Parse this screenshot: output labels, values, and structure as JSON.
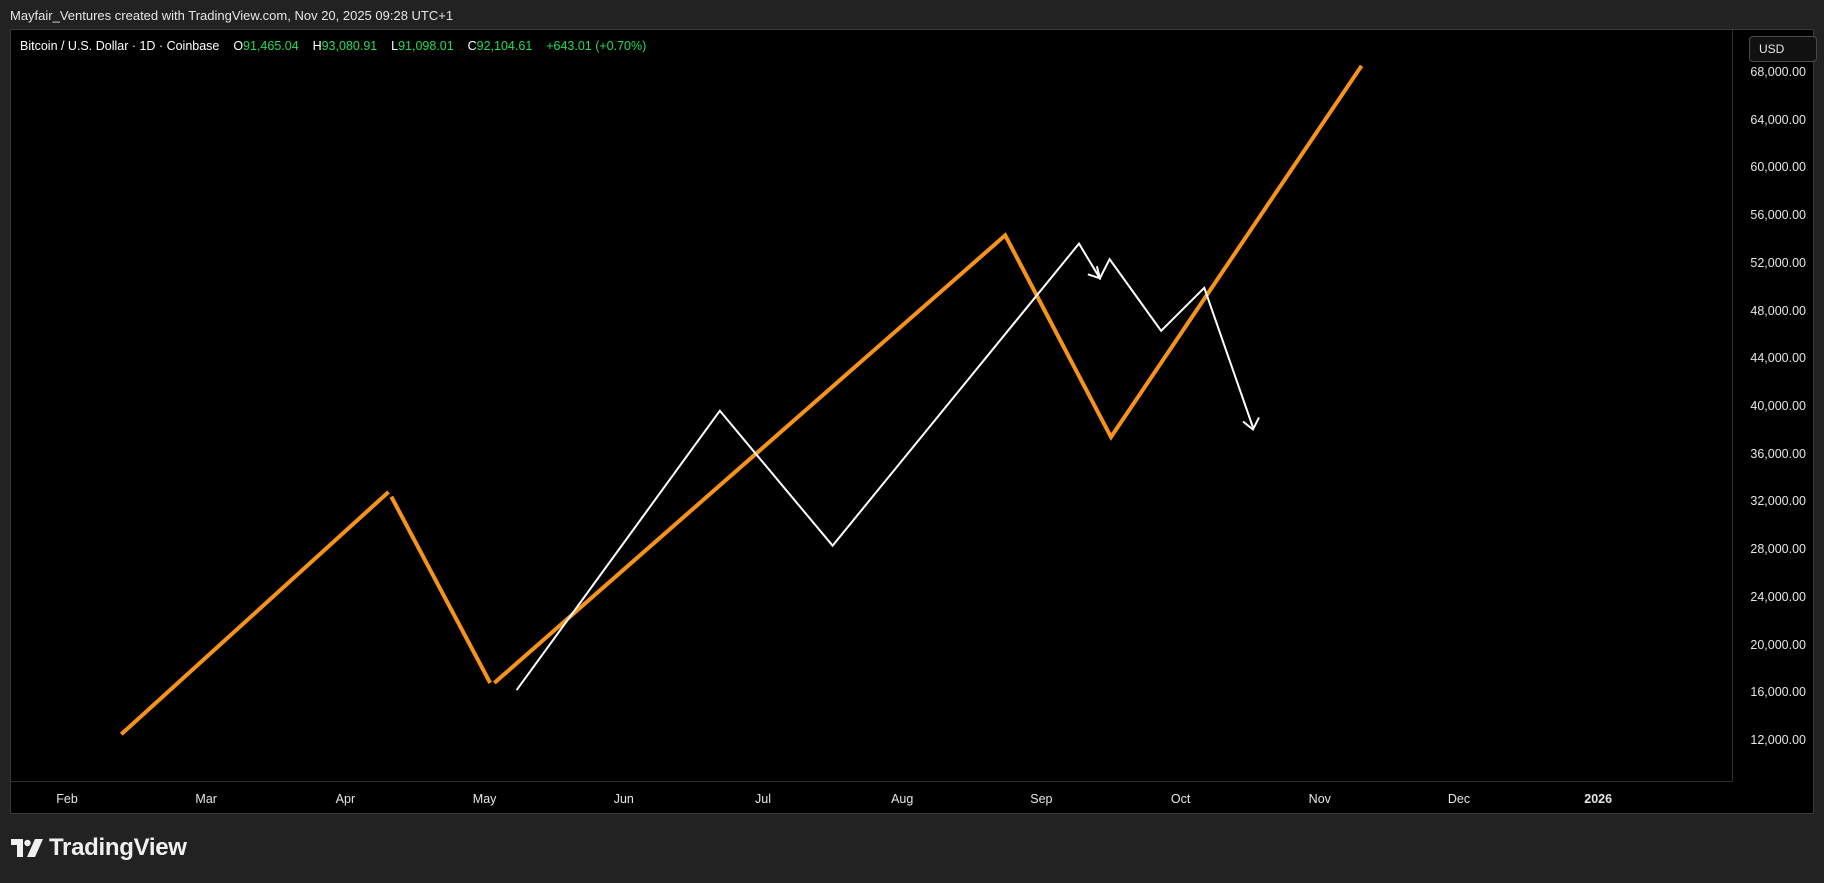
{
  "caption": "Mayfair_Ventures created with TradingView.com, Nov 20, 2025 09:28 UTC+1",
  "legend": {
    "symbol": "Bitcoin / U.S. Dollar · 1D · Coinbase",
    "o_label": "O",
    "o_value": "91,465.04",
    "h_label": "H",
    "h_value": "93,080.91",
    "l_label": "L",
    "l_value": "91,098.01",
    "c_label": "C",
    "c_value": "92,104.61",
    "change": "+643.01 (+0.70%)"
  },
  "currency_button": "USD",
  "brand": "TradingView",
  "colors": {
    "background": "#000000",
    "projection_line": "#f7931a",
    "price_path": "#ffffff",
    "legend_value": "#22dd55"
  },
  "chart_data": {
    "type": "line",
    "x_tick_labels": [
      "Feb",
      "Mar",
      "Apr",
      "May",
      "Jun",
      "Jul",
      "Aug",
      "Sep",
      "Oct",
      "Nov",
      "Dec",
      "2026"
    ],
    "y_tick_labels": [
      "68,000.00",
      "64,000.00",
      "60,000.00",
      "56,000.00",
      "52,000.00",
      "48,000.00",
      "44,000.00",
      "40,000.00",
      "36,000.00",
      "32,000.00",
      "28,000.00",
      "24,000.00",
      "20,000.00",
      "16,000.00",
      "12,000.00"
    ],
    "ylim": [
      8500,
      71500
    ],
    "x_axis": "month index (Feb = 0, 2026 = 11)",
    "series": [
      {
        "style": "orange-thick",
        "points": [
          [
            0.39,
            12500
          ],
          [
            2.31,
            32800
          ]
        ]
      },
      {
        "style": "orange-thick",
        "points": [
          [
            2.33,
            32400
          ],
          [
            3.04,
            16800
          ]
        ]
      },
      {
        "style": "orange-thick",
        "points": [
          [
            3.07,
            16800
          ],
          [
            6.74,
            54300
          ],
          [
            7.5,
            37400
          ],
          [
            9.3,
            68500
          ]
        ]
      },
      {
        "style": "white-thin",
        "points": [
          [
            3.23,
            16200
          ],
          [
            4.69,
            39600
          ],
          [
            5.5,
            28300
          ],
          [
            7.27,
            53600
          ],
          [
            7.42,
            50700
          ],
          [
            7.49,
            52300
          ],
          [
            7.86,
            46300
          ],
          [
            8.17,
            49900
          ],
          [
            8.52,
            38200
          ]
        ]
      }
    ],
    "arrows": [
      {
        "at": [
          7.42,
          50700
        ],
        "direction": "down-right"
      },
      {
        "at": [
          8.52,
          38200
        ],
        "direction": "down"
      }
    ]
  }
}
